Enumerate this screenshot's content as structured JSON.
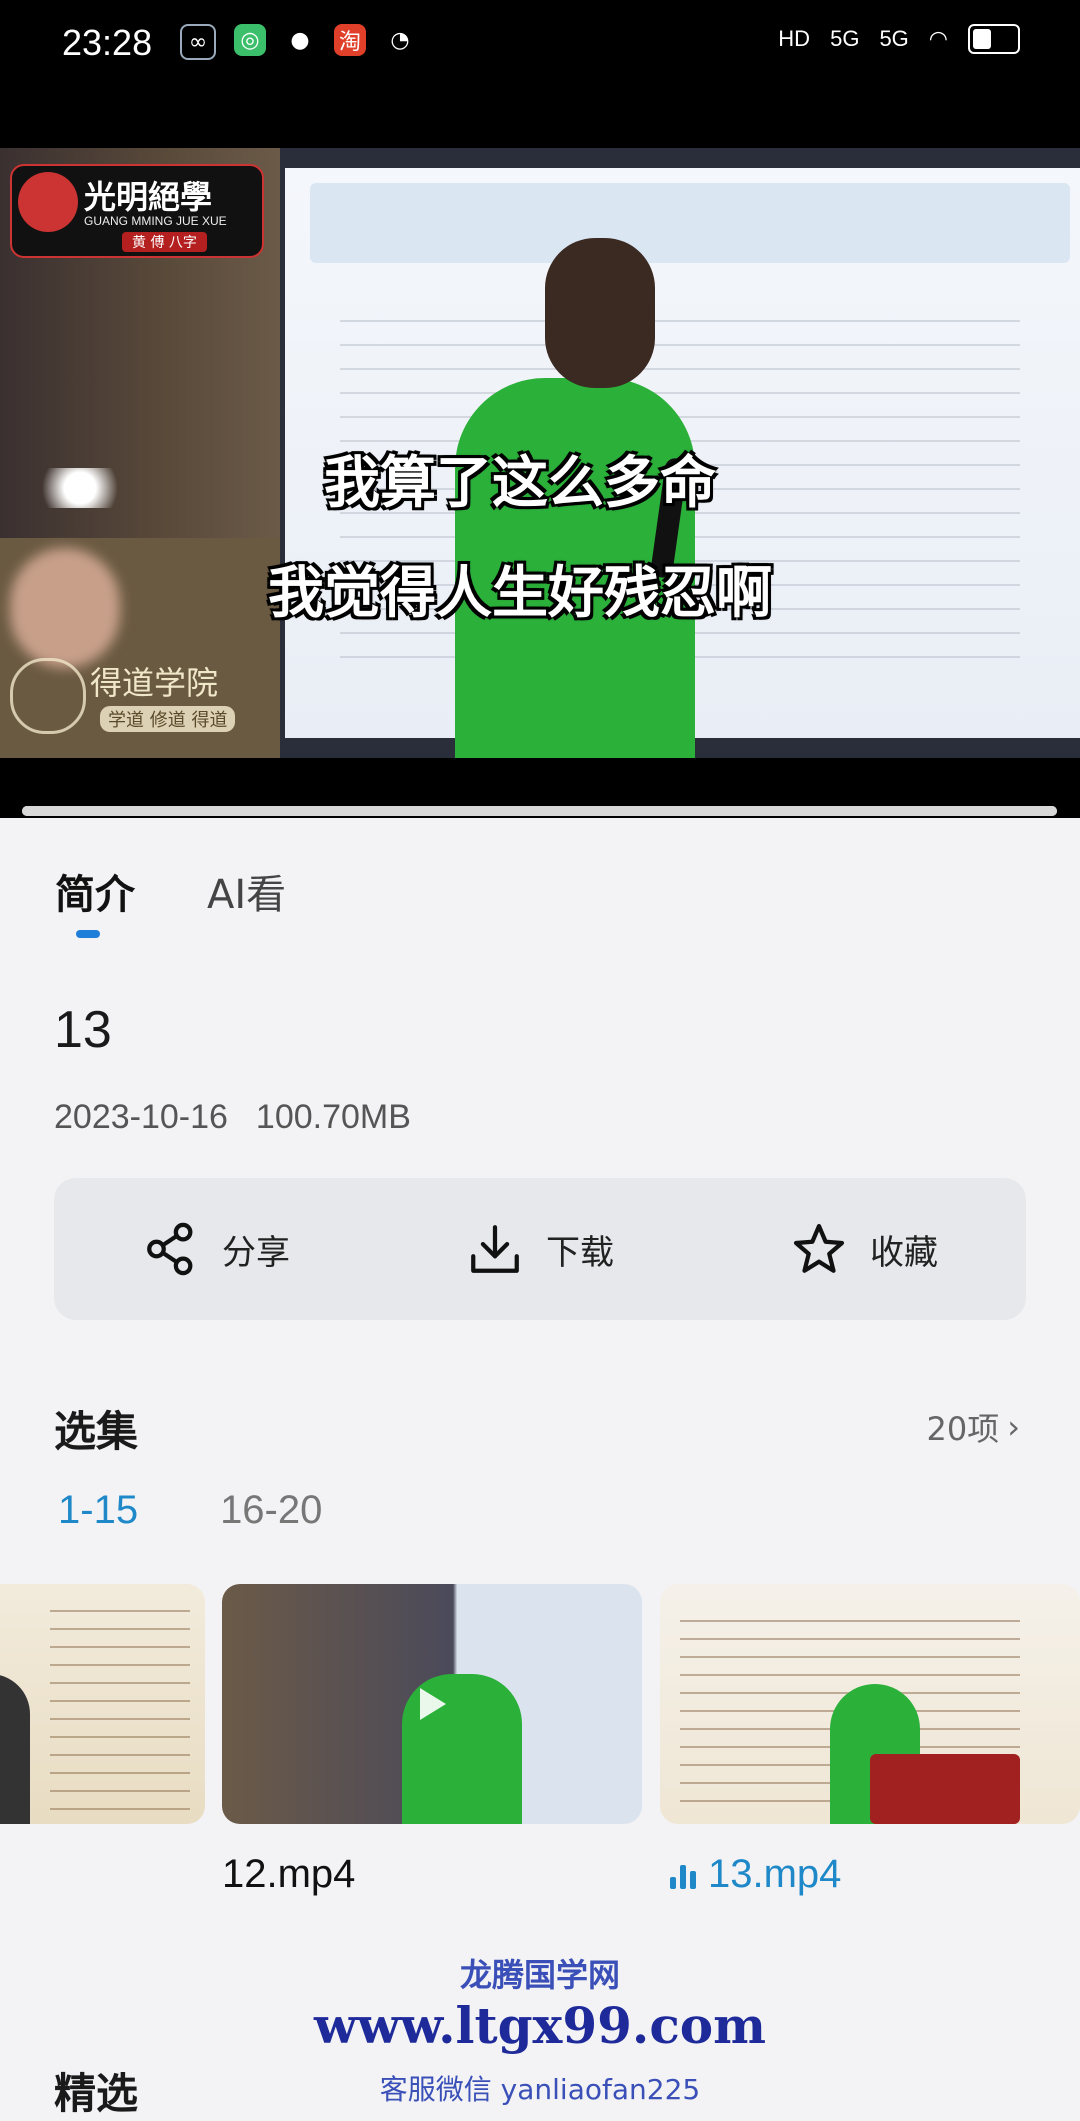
{
  "status": {
    "time": "23:28",
    "network": "5G",
    "hd": "HD"
  },
  "video": {
    "subtitle_line1": "我算了这么多命",
    "subtitle_line2": "我觉得人生好残忍啊",
    "logo_title": "光明絕學",
    "logo_sub": "GUANG MMING JUE XUE",
    "logo_tag": "黄 傅 八字",
    "watermark_title": "得道学院",
    "watermark_sub": "学道 修道 得道",
    "progress": 1.0
  },
  "tabs": [
    {
      "label": "简介",
      "active": true
    },
    {
      "label": "AI看",
      "active": false
    }
  ],
  "detail": {
    "title": "13",
    "date": "2023-10-16",
    "size": "100.70MB"
  },
  "actions": {
    "share": "分享",
    "download": "下载",
    "favorite": "收藏"
  },
  "episodes": {
    "title": "选集",
    "count": "20项",
    "ranges": [
      "1-15",
      "16-20"
    ],
    "items": [
      {
        "label": "12.mp4",
        "playing": false
      },
      {
        "label": "13.mp4",
        "playing": true
      }
    ]
  },
  "featured": {
    "title": "精选"
  },
  "site_watermark": {
    "name": "龙腾国学网",
    "url": "www.ltgx99.com",
    "contact": "客服微信 yanliaofan225"
  },
  "colors": {
    "accent": "#1e88c8",
    "indicator": "#1e7fd8",
    "subject_green": "#2bb03a"
  }
}
